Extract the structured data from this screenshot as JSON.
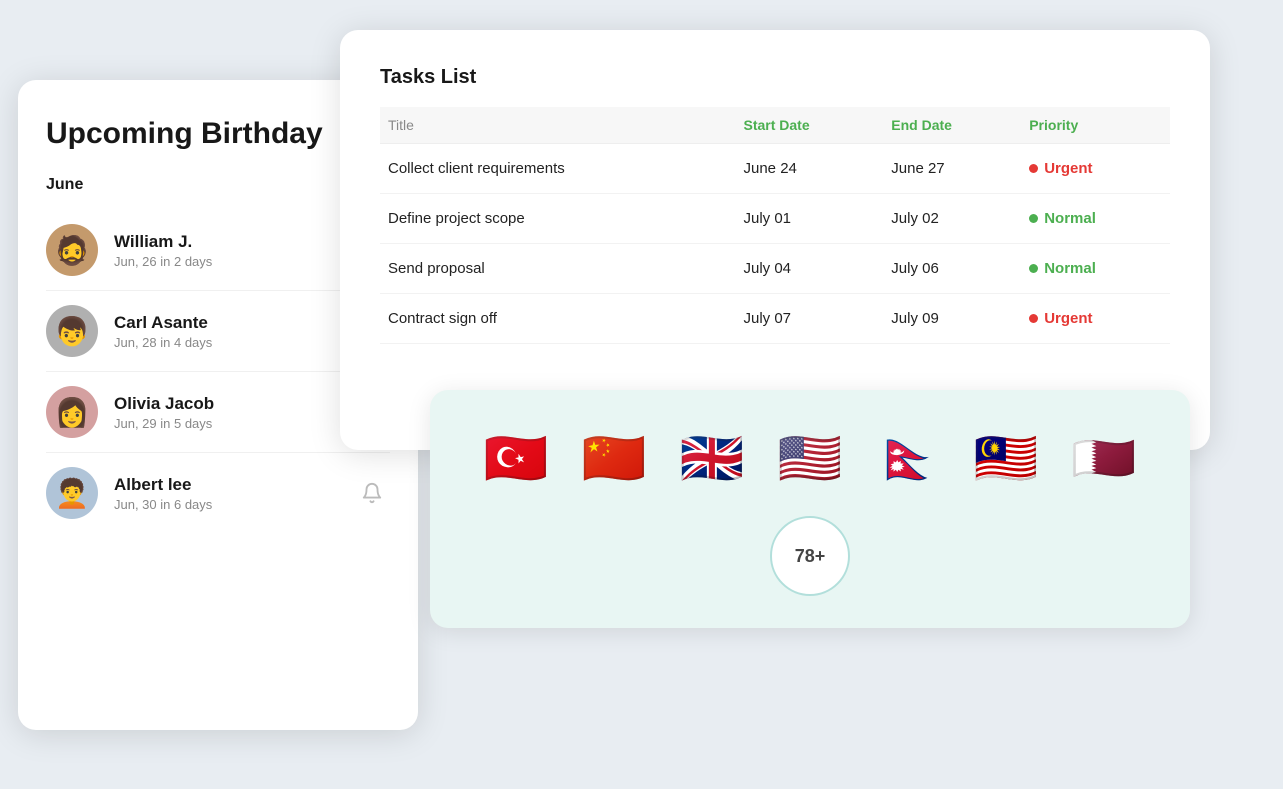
{
  "birthday_card": {
    "title": "Upcoming Birthday",
    "month": "June",
    "people": [
      {
        "name": "William J.",
        "date": "Jun, 26 in 2 days",
        "avatar_color": "#c49a6c",
        "avatar_emoji": "👨"
      },
      {
        "name": "Carl Asante",
        "date": "Jun, 28 in 4 days",
        "avatar_color": "#b0b0b0",
        "avatar_emoji": "🧑"
      },
      {
        "name": "Olivia Jacob",
        "date": "Jun, 29 in 5 days",
        "avatar_color": "#d4a0a0",
        "avatar_emoji": "👩"
      },
      {
        "name": "Albert lee",
        "date": "Jun, 30 in 6 days",
        "avatar_color": "#b0c4d8",
        "avatar_emoji": "👨"
      }
    ]
  },
  "tasks_card": {
    "title": "Tasks List",
    "columns": {
      "title": "Title",
      "start_date": "Start Date",
      "end_date": "End Date",
      "priority": "Priority"
    },
    "tasks": [
      {
        "title": "Collect client requirements",
        "start": "June 24",
        "end": "June 27",
        "priority": "Urgent",
        "type": "urgent"
      },
      {
        "title": "Define project scope",
        "start": "July 01",
        "end": "July 02",
        "priority": "Normal",
        "type": "normal"
      },
      {
        "title": "Send proposal",
        "start": "July 04",
        "end": "July 06",
        "priority": "Normal",
        "type": "normal"
      },
      {
        "title": "Contract sign off",
        "start": "July 07",
        "end": "July 09",
        "priority": "Urgent",
        "type": "urgent"
      }
    ]
  },
  "flags_card": {
    "flags": [
      {
        "emoji": "🇹🇷",
        "name": "Turkey",
        "rounded": true
      },
      {
        "emoji": "🇨🇳",
        "name": "China",
        "rounded": true
      },
      {
        "emoji": "🇬🇧",
        "name": "United Kingdom",
        "rounded": false
      },
      {
        "emoji": "🇺🇸",
        "name": "United States",
        "rounded": false
      },
      {
        "emoji": "🇳🇵",
        "name": "Nepal",
        "rounded": false
      },
      {
        "emoji": "🇲🇾",
        "name": "Malaysia",
        "rounded": false
      },
      {
        "emoji": "🇶🇦",
        "name": "Qatar",
        "rounded": true
      }
    ],
    "more_count": "78+"
  },
  "avatars": {
    "william_emoji": "🧔",
    "carl_emoji": "👦",
    "olivia_emoji": "👩",
    "albert_emoji": "🧑"
  }
}
